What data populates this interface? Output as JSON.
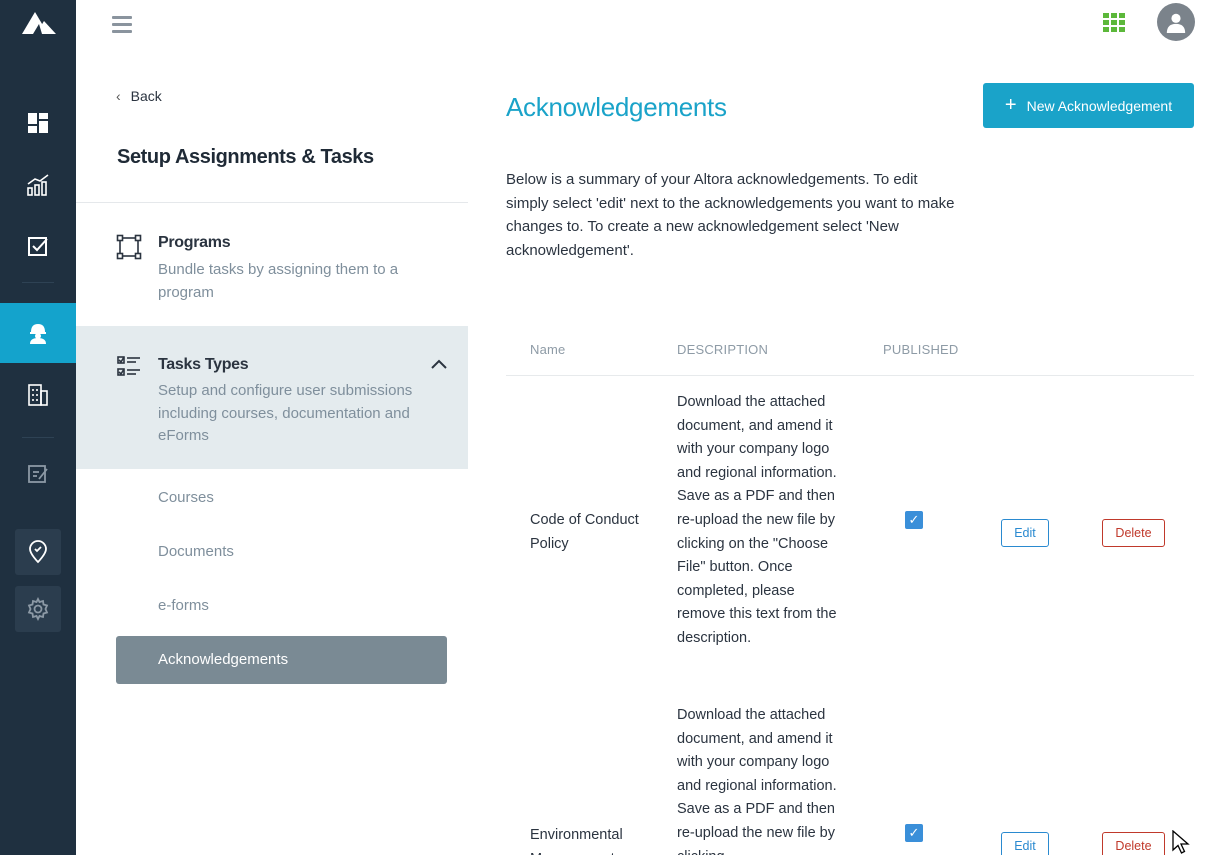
{
  "topbar": {
    "menu_icon": "hamburger-icon",
    "apps_icon": "apps-grid-icon",
    "avatar_icon": "user-icon"
  },
  "rail": {
    "items": [
      {
        "icon": "dashboard-icon"
      },
      {
        "icon": "analytics-icon"
      },
      {
        "icon": "checkbox-icon"
      },
      {
        "icon": "user-hardhat-icon",
        "active": true
      },
      {
        "icon": "building-icon"
      },
      {
        "icon": "edit-note-icon"
      },
      {
        "icon": "location-pin-icon"
      },
      {
        "icon": "gear-icon"
      }
    ],
    "colors": {
      "background": "#1f3040",
      "active": "#14a3cc"
    }
  },
  "subnav": {
    "back_label": "Back",
    "title": "Setup Assignments & Tasks",
    "programs": {
      "title": "Programs",
      "description": "Bundle tasks by assigning them to a program"
    },
    "tasks": {
      "title": "Tasks Types",
      "description": "Setup and configure user submissions including courses, documentation and eForms"
    },
    "items": [
      "Courses",
      "Documents",
      "e-forms",
      "Acknowledgements"
    ]
  },
  "main": {
    "title": "Acknowledgements",
    "new_button": "New Acknowledgement",
    "intro": "Below is a summary of your Altora acknowledgements. To edit simply select 'edit' next to the acknowledgements you want to make changes to. To create a new acknowledgement select 'New acknowledgement'.",
    "columns": {
      "name": "Name",
      "description": "DESCRIPTION",
      "published": "PUBLISHED"
    },
    "rows": [
      {
        "name": "Code of Conduct Policy",
        "description": "Download the attached document, and amend it with your company logo and regional information. Save as a PDF and then re-upload the new file by clicking on the \"Choose File\" button. Once completed, please remove this text from the description.",
        "published": true,
        "edit": "Edit",
        "delete": "Delete"
      },
      {
        "name": "Environmental Management",
        "description": "Download the attached document, and amend it with your company logo and regional information. Save as a PDF and then re-upload the new file by clicking",
        "published": true,
        "edit": "Edit",
        "delete": "Delete"
      }
    ],
    "check_glyph": "✓",
    "colors": {
      "accent": "#1aa3c9",
      "delete": "#c0392b",
      "edit": "#2a8ad0"
    }
  }
}
